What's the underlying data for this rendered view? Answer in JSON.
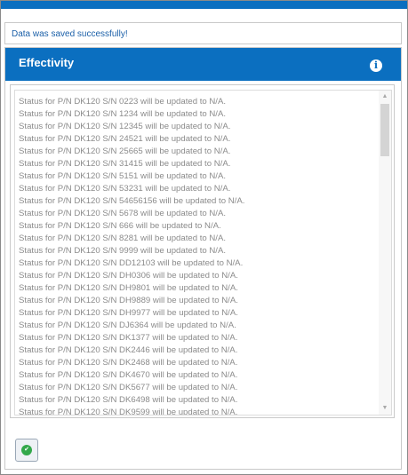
{
  "message": {
    "success_text": "Data was saved successfully!"
  },
  "panel": {
    "title": "Effectivity",
    "info_icon": "info-circle-icon"
  },
  "status_list": [
    "Status for P/N DK120 S/N 0223 will be updated to N/A.",
    "Status for P/N DK120 S/N 1234 will be updated to N/A.",
    "Status for P/N DK120 S/N 12345 will be updated to N/A.",
    "Status for P/N DK120 S/N 24521 will be updated to N/A.",
    "Status for P/N DK120 S/N 25665 will be updated to N/A.",
    "Status for P/N DK120 S/N 31415 will be updated to N/A.",
    "Status for P/N DK120 S/N 5151 will be updated to N/A.",
    "Status for P/N DK120 S/N 53231 will be updated to N/A.",
    "Status for P/N DK120 S/N 54656156 will be updated to N/A.",
    "Status for P/N DK120 S/N 5678 will be updated to N/A.",
    "Status for P/N DK120 S/N 666 will be updated to N/A.",
    "Status for P/N DK120 S/N 8281 will be updated to N/A.",
    "Status for P/N DK120 S/N 9999 will be updated to N/A.",
    "Status for P/N DK120 S/N DD12103 will be updated to N/A.",
    "Status for P/N DK120 S/N DH0306 will be updated to N/A.",
    "Status for P/N DK120 S/N DH9801 will be updated to N/A.",
    "Status for P/N DK120 S/N DH9889 will be updated to N/A.",
    "Status for P/N DK120 S/N DH9977 will be updated to N/A.",
    "Status for P/N DK120 S/N DJ6364 will be updated to N/A.",
    "Status for P/N DK120 S/N DK1377 will be updated to N/A.",
    "Status for P/N DK120 S/N DK2446 will be updated to N/A.",
    "Status for P/N DK120 S/N DK2468 will be updated to N/A.",
    "Status for P/N DK120 S/N DK4670 will be updated to N/A.",
    "Status for P/N DK120 S/N DK5677 will be updated to N/A.",
    "Status for P/N DK120 S/N DK6498 will be updated to N/A.",
    "Status for P/N DK120 S/N DK9599 will be updated to N/A."
  ],
  "scrollbar": {
    "up_icon": "scroll-up-arrow-icon",
    "down_icon": "scroll-down-arrow-icon"
  },
  "approve_button": {
    "icon": "thumbs-up-icon"
  },
  "colors": {
    "header_blue": "#0b6fc0",
    "message_text": "#1a5fa8",
    "list_text": "#8b8b8b",
    "approve_green": "#33a84a"
  }
}
